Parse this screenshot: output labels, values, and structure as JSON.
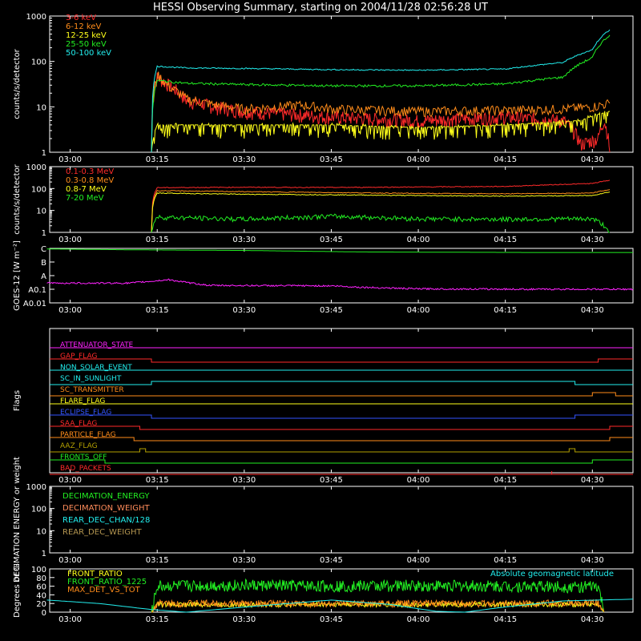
{
  "title": "HESSI Observing Summary, starting on 2004/11/28 02:56:28 UT",
  "time_ticks": [
    "03:00",
    "03:15",
    "03:30",
    "03:45",
    "04:00",
    "04:15",
    "04:30"
  ],
  "colors": {
    "red": "#ff2a2a",
    "orange": "#ff8c1a",
    "yellow": "#ffff1a",
    "green": "#22ee22",
    "cyan": "#22eeee",
    "magenta": "#ff22ff",
    "blue": "#3355ff",
    "olive": "#b4a000",
    "peach": "#ff8c5a",
    "tan": "#b49650",
    "frame": "#ffffff"
  },
  "chart_data": [
    {
      "type": "line",
      "title": "HESSI Observing Summary, starting on 2004/11/28 02:56:28 UT",
      "ylabel": "counts/s/detector",
      "yscale": "log",
      "ylim": [
        1,
        1000
      ],
      "y_ticks": [
        "1",
        "10",
        "100",
        "1000"
      ],
      "data_window": [
        "03:14",
        "04:33"
      ],
      "series": [
        {
          "name": "3-6 keV",
          "color": "red",
          "points": [
            [
              "03:14",
              1
            ],
            [
              "03:15",
              45
            ],
            [
              "03:17",
              30
            ],
            [
              "03:20",
              14
            ],
            [
              "03:25",
              10
            ],
            [
              "03:30",
              8
            ],
            [
              "03:45",
              6
            ],
            [
              "04:00",
              5
            ],
            [
              "04:15",
              6
            ],
            [
              "04:25",
              5
            ],
            [
              "04:28",
              1.5
            ],
            [
              "04:31",
              2
            ],
            [
              "04:32",
              5
            ],
            [
              "04:33",
              1
            ]
          ]
        },
        {
          "name": "6-12 keV",
          "color": "orange",
          "points": [
            [
              "03:14",
              1
            ],
            [
              "03:15",
              50
            ],
            [
              "03:17",
              28
            ],
            [
              "03:20",
              15
            ],
            [
              "03:25",
              11
            ],
            [
              "03:30",
              9
            ],
            [
              "03:40",
              11
            ],
            [
              "03:45",
              9
            ],
            [
              "04:00",
              8
            ],
            [
              "04:15",
              8.5
            ],
            [
              "04:25",
              9
            ],
            [
              "04:30",
              10
            ],
            [
              "04:33",
              12
            ]
          ]
        },
        {
          "name": "12-25 keV",
          "color": "yellow",
          "points": [
            [
              "03:14",
              1
            ],
            [
              "03:15",
              4
            ],
            [
              "03:30",
              4
            ],
            [
              "03:45",
              4
            ],
            [
              "04:00",
              3.5
            ],
            [
              "04:15",
              4
            ],
            [
              "04:28",
              5
            ],
            [
              "04:33",
              8
            ]
          ]
        },
        {
          "name": "25-50 keV",
          "color": "green",
          "points": [
            [
              "03:14",
              1
            ],
            [
              "03:15",
              38
            ],
            [
              "03:20",
              33
            ],
            [
              "03:30",
              31
            ],
            [
              "03:45",
              29
            ],
            [
              "04:00",
              29
            ],
            [
              "04:15",
              32
            ],
            [
              "04:25",
              45
            ],
            [
              "04:30",
              120
            ],
            [
              "04:33",
              380
            ]
          ]
        },
        {
          "name": "50-100 keV",
          "color": "cyan",
          "points": [
            [
              "03:14",
              1
            ],
            [
              "03:15",
              78
            ],
            [
              "03:20",
              72
            ],
            [
              "03:30",
              70
            ],
            [
              "03:45",
              66
            ],
            [
              "04:00",
              64
            ],
            [
              "04:15",
              68
            ],
            [
              "04:25",
              95
            ],
            [
              "04:30",
              180
            ],
            [
              "04:33",
              500
            ]
          ]
        }
      ]
    },
    {
      "type": "line",
      "ylabel": "counts/s/detector",
      "yscale": "log",
      "ylim": [
        1,
        1000
      ],
      "y_ticks": [
        "1",
        "10",
        "100",
        "1000"
      ],
      "data_window": [
        "03:14",
        "04:33"
      ],
      "series": [
        {
          "name": "0.1-0.3 MeV",
          "color": "red",
          "points": [
            [
              "03:14",
              1
            ],
            [
              "03:15",
              110
            ],
            [
              "03:30",
              115
            ],
            [
              "03:45",
              112
            ],
            [
              "04:00",
              118
            ],
            [
              "04:15",
              125
            ],
            [
              "04:30",
              170
            ],
            [
              "04:33",
              240
            ]
          ]
        },
        {
          "name": "0.3-0.8 MeV",
          "color": "orange",
          "points": [
            [
              "03:14",
              1
            ],
            [
              "03:15",
              80
            ],
            [
              "03:30",
              72
            ],
            [
              "03:45",
              66
            ],
            [
              "04:00",
              60
            ],
            [
              "04:15",
              58
            ],
            [
              "04:30",
              62
            ],
            [
              "04:33",
              90
            ]
          ]
        },
        {
          "name": "0.8-7 MeV",
          "color": "yellow",
          "points": [
            [
              "03:14",
              1
            ],
            [
              "03:15",
              62
            ],
            [
              "03:30",
              55
            ],
            [
              "03:45",
              52
            ],
            [
              "04:00",
              48
            ],
            [
              "04:15",
              45
            ],
            [
              "04:30",
              48
            ],
            [
              "04:33",
              70
            ]
          ]
        },
        {
          "name": "7-20 MeV",
          "color": "green",
          "points": [
            [
              "03:14",
              1
            ],
            [
              "03:15",
              5
            ],
            [
              "03:30",
              4
            ],
            [
              "03:45",
              5.5
            ],
            [
              "04:00",
              4.2
            ],
            [
              "04:15",
              4
            ],
            [
              "04:30",
              4.2
            ],
            [
              "04:33",
              1
            ]
          ]
        }
      ]
    },
    {
      "type": "line",
      "ylabel": "GOES-12 [W m⁻²]",
      "y_ticks": [
        "A0.01",
        "A0.1",
        "A",
        "B",
        "C"
      ],
      "series": [
        {
          "color": "green",
          "level_scale": "A0.01=0,A0.1=1,A=2,B=3,C=4",
          "points": [
            [
              "02:56",
              3.96
            ],
            [
              "03:10",
              3.9
            ],
            [
              "03:30",
              3.85
            ],
            [
              "03:50",
              3.74
            ],
            [
              "04:20",
              3.7
            ],
            [
              "04:37",
              3.7
            ]
          ]
        },
        {
          "color": "magenta",
          "level_scale": "A0.01=0,A0.1=1,A=2,B=3,C=4",
          "points": [
            [
              "02:56",
              1.45
            ],
            [
              "03:10",
              1.45
            ],
            [
              "03:13",
              1.55
            ],
            [
              "03:17",
              1.7
            ],
            [
              "03:20",
              1.5
            ],
            [
              "03:24",
              1.28
            ],
            [
              "03:45",
              1.25
            ],
            [
              "03:50",
              1.15
            ],
            [
              "04:00",
              1.03
            ],
            [
              "04:20",
              1.0
            ],
            [
              "04:37",
              1.0
            ]
          ]
        }
      ]
    },
    {
      "type": "line",
      "ylabel": "Flags",
      "flags": [
        {
          "name": "ATTENUATOR_STATE",
          "color": "magenta",
          "transitions": []
        },
        {
          "name": "GAP_FLAG",
          "color": "red",
          "transitions": [
            [
              "03:14",
              "low"
            ],
            [
              "04:31",
              "high"
            ]
          ]
        },
        {
          "name": "NON_SOLAR_EVENT",
          "color": "cyan",
          "transitions": []
        },
        {
          "name": "SC_IN_SUNLIGHT",
          "color": "cyan",
          "transitions": [
            [
              "03:14",
              "high"
            ],
            [
              "04:27",
              "low"
            ]
          ]
        },
        {
          "name": "SC_TRANSMITTER",
          "color": "orange",
          "transitions": [
            [
              "04:30",
              "high"
            ],
            [
              "04:34",
              "low"
            ]
          ]
        },
        {
          "name": "FLARE_FLAG",
          "color": "yellow",
          "transitions": []
        },
        {
          "name": "ECLIPSE_FLAG",
          "color": "blue",
          "transitions": [
            [
              "03:14",
              "low"
            ],
            [
              "04:27",
              "high"
            ]
          ]
        },
        {
          "name": "SAA_FLAG",
          "color": "red",
          "transitions": [
            [
              "03:12",
              "low"
            ],
            [
              "04:33",
              "high"
            ]
          ]
        },
        {
          "name": "PARTICLE_FLAG",
          "color": "orange",
          "transitions": [
            [
              "03:11",
              "low"
            ],
            [
              "04:33",
              "high"
            ]
          ]
        },
        {
          "name": "AAZ_FLAG",
          "color": "olive",
          "transitions": [
            [
              "03:12",
              "high"
            ],
            [
              "03:13",
              "low"
            ],
            [
              "04:26",
              "high"
            ],
            [
              "04:27",
              "low"
            ]
          ]
        },
        {
          "name": "FRONTS_OFF",
          "color": "green",
          "transitions": [
            [
              "03:06",
              "low"
            ],
            [
              "04:30",
              "high"
            ]
          ]
        },
        {
          "name": "BAD_PACKETS",
          "color": "red",
          "transitions": [
            [
              "04:23",
              "high"
            ],
            [
              "04:23",
              "low"
            ]
          ]
        }
      ]
    },
    {
      "type": "line",
      "ylabel": "DECIMATION ENERGY or weight",
      "yscale": "log",
      "ylim": [
        1,
        1000
      ],
      "y_ticks": [
        "1",
        "10",
        "100",
        "1000"
      ],
      "series": [
        {
          "name": "DECIMATION_ENERGY",
          "color": "green",
          "points": []
        },
        {
          "name": "DECIMATION_WEIGHT",
          "color": "peach",
          "points": []
        },
        {
          "name": "REAR_DEC_CHAN/128",
          "color": "cyan",
          "points": []
        },
        {
          "name": "REAR_DEC_WEIGHT",
          "color": "tan",
          "points": []
        }
      ]
    },
    {
      "type": "line",
      "ylabel": "Degrees or %",
      "ylim": [
        0,
        100
      ],
      "y_ticks": [
        "0",
        "20",
        "40",
        "60",
        "80",
        "100"
      ],
      "annotation": "Absolute geomagnetic latitude",
      "series": [
        {
          "name": "FRONT_RATIO",
          "color": "yellow",
          "points": [
            [
              "03:14",
              0
            ],
            [
              "03:15",
              18
            ],
            [
              "03:30",
              17
            ],
            [
              "03:45",
              18
            ],
            [
              "04:00",
              17
            ],
            [
              "04:15",
              18
            ],
            [
              "04:31",
              18
            ],
            [
              "04:32",
              0
            ]
          ]
        },
        {
          "name": "FRONT_RATIO_1225",
          "color": "green",
          "points": [
            [
              "03:14",
              0
            ],
            [
              "03:15",
              60
            ],
            [
              "03:30",
              62
            ],
            [
              "03:45",
              60
            ],
            [
              "04:00",
              61
            ],
            [
              "04:15",
              60
            ],
            [
              "04:31",
              58
            ],
            [
              "04:32",
              0
            ]
          ]
        },
        {
          "name": "MAX_DET_VS_TOT",
          "color": "orange",
          "points": [
            [
              "03:14",
              0
            ],
            [
              "03:15",
              20
            ],
            [
              "03:30",
              20
            ],
            [
              "03:45",
              19
            ],
            [
              "04:00",
              20
            ],
            [
              "04:15",
              20
            ],
            [
              "04:31",
              21
            ],
            [
              "04:32",
              0
            ]
          ]
        },
        {
          "color": "cyan",
          "points": [
            [
              "02:56",
              28
            ],
            [
              "03:05",
              20
            ],
            [
              "03:14",
              6
            ],
            [
              "03:20",
              0
            ],
            [
              "03:32",
              14
            ],
            [
              "03:45",
              28
            ],
            [
              "03:55",
              18
            ],
            [
              "04:03",
              2
            ],
            [
              "04:08",
              0
            ],
            [
              "04:15",
              12
            ],
            [
              "04:25",
              26
            ],
            [
              "04:37",
              30
            ]
          ]
        }
      ]
    }
  ]
}
